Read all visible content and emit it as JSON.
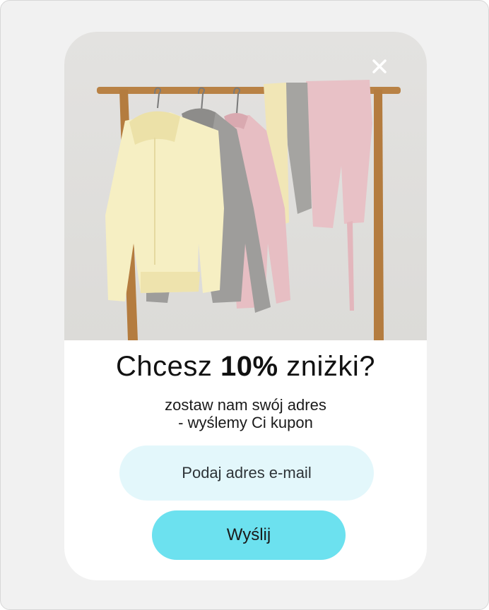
{
  "popup": {
    "headline_pre": "Chcesz ",
    "headline_bold": "10%",
    "headline_post": " zniżki?",
    "subtitle_line1": "zostaw nam swój adres",
    "subtitle_line2": "- wyślemy Ci kupon",
    "email_placeholder": "Podaj adres e-mail",
    "submit_label": "Wyślij"
  },
  "colors": {
    "page_background": "#f1f1f1",
    "popup_background": "#ffffff",
    "email_field_background": "#e3f7fb",
    "submit_button_background": "#6ce1ef"
  },
  "icons": {
    "close": "close-icon"
  }
}
